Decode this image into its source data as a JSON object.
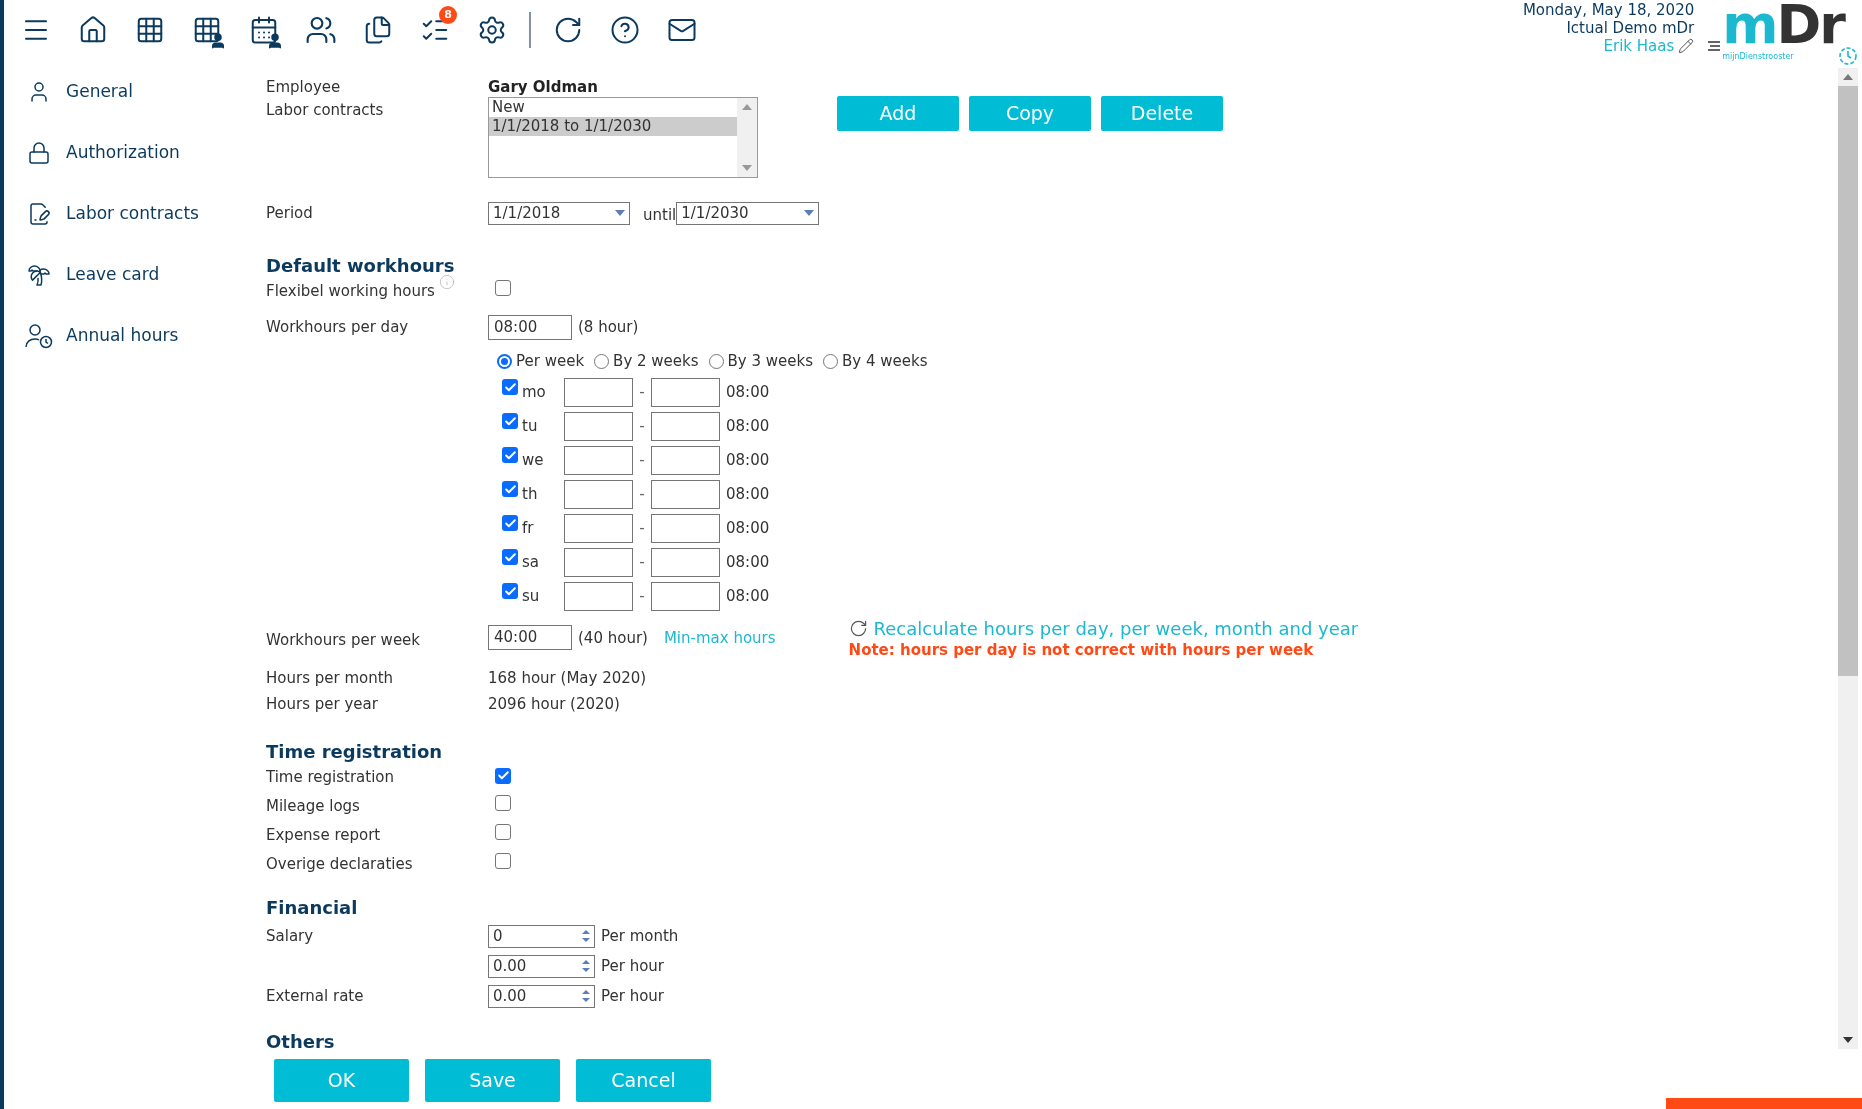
{
  "toolbar": {
    "badge": "8"
  },
  "header": {
    "date": "Monday, May 18, 2020",
    "company": "Ictual Demo mDr",
    "user": "Erik Haas"
  },
  "logo": {
    "text": "mDr",
    "tagline": "mijnDienstrooster"
  },
  "sidebar": {
    "items": [
      {
        "label": "General",
        "kind": "user"
      },
      {
        "label": "Authorization",
        "kind": "lock"
      },
      {
        "label": "Labor contracts",
        "kind": "contract"
      },
      {
        "label": "Leave card",
        "kind": "beach"
      },
      {
        "label": "Annual hours",
        "kind": "clock"
      }
    ]
  },
  "employee": {
    "label": "Employee",
    "value": "Gary Oldman"
  },
  "labor_contracts": {
    "label": "Labor contracts",
    "options": [
      {
        "text": "New",
        "selected": false
      },
      {
        "text": "1/1/2018 to 1/1/2030",
        "selected": true
      }
    ],
    "buttons": [
      "Add",
      "Copy",
      "Delete"
    ]
  },
  "period": {
    "label": "Period",
    "from": "1/1/2018",
    "until_label": "until",
    "until": "1/1/2030"
  },
  "default_workhours": {
    "heading": "Default workhours",
    "flexible": {
      "label": "Flexibel working hours",
      "checked": false
    },
    "per_day": {
      "label": "Workhours per day",
      "value": "08:00",
      "note": "(8 hour)"
    },
    "periods": [
      {
        "label": "Per week",
        "selected": true
      },
      {
        "label": "By 2 weeks",
        "selected": false
      },
      {
        "label": "By 3 weeks",
        "selected": false
      },
      {
        "label": "By 4 weeks",
        "selected": false
      }
    ],
    "days": [
      {
        "label": "mo",
        "checked": true,
        "hours": "08:00"
      },
      {
        "label": "tu",
        "checked": true,
        "hours": "08:00"
      },
      {
        "label": "we",
        "checked": true,
        "hours": "08:00"
      },
      {
        "label": "th",
        "checked": true,
        "hours": "08:00"
      },
      {
        "label": "fr",
        "checked": true,
        "hours": "08:00"
      },
      {
        "label": "sa",
        "checked": true,
        "hours": "08:00"
      },
      {
        "label": "su",
        "checked": true,
        "hours": "08:00"
      }
    ],
    "day_separator": "-",
    "per_week": {
      "label": "Workhours per week",
      "value": "40:00",
      "note": "(40 hour)",
      "link": "Min-max hours"
    },
    "recalculate": "Recalculate hours per day, per week, month and year",
    "warning": "Note: hours per day is not correct with hours per week",
    "per_month": {
      "label": "Hours per month",
      "value": "168 hour (May 2020)"
    },
    "per_year": {
      "label": "Hours per year",
      "value": "2096 hour (2020)"
    }
  },
  "time_registration": {
    "heading": "Time registration",
    "items": [
      {
        "label": "Time registration",
        "checked": true
      },
      {
        "label": "Mileage logs",
        "checked": false
      },
      {
        "label": "Expense report",
        "checked": false
      },
      {
        "label": "Overige declaraties",
        "checked": false
      }
    ]
  },
  "financial": {
    "heading": "Financial",
    "rows": [
      {
        "label": "Salary",
        "value": "0",
        "unit": "Per month"
      },
      {
        "value": "0.00",
        "unit": "Per hour"
      },
      {
        "label": "External rate",
        "value": "0.00",
        "unit": "Per hour"
      }
    ]
  },
  "others": {
    "heading": "Others"
  },
  "footer_buttons": [
    "OK",
    "Save",
    "Cancel"
  ]
}
